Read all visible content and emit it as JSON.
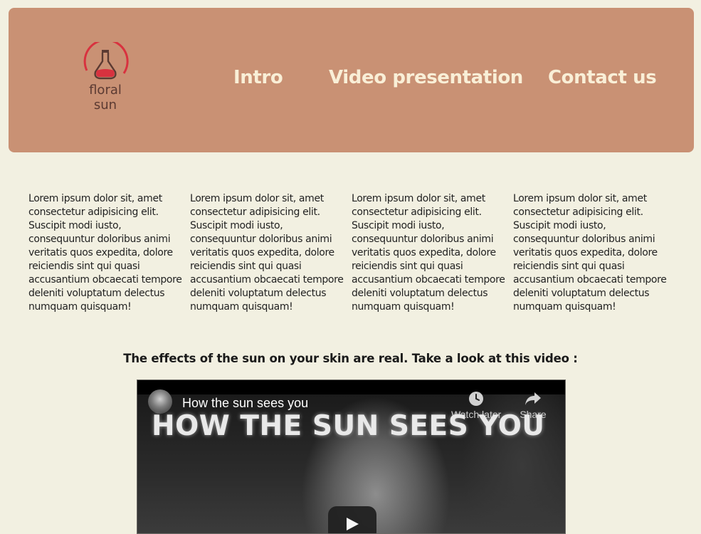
{
  "logo": {
    "line1": "floral",
    "line2": "sun"
  },
  "nav": [
    {
      "label": "Intro"
    },
    {
      "label": "Video presentation"
    },
    {
      "label": "Contact us"
    }
  ],
  "columns": [
    {
      "text": "Lorem ipsum dolor sit, amet consectetur adipisicing elit. Suscipit modi iusto, consequuntur doloribus animi veritatis quos expedita, dolore reiciendis sint qui quasi accusantium obcaecati tempore deleniti voluptatum delectus numquam quisquam!"
    },
    {
      "text": "Lorem ipsum dolor sit, amet consectetur adipisicing elit. Suscipit modi iusto, consequuntur doloribus animi veritatis quos expedita, dolore reiciendis sint qui quasi accusantium obcaecati tempore deleniti voluptatum delectus numquam quisquam!"
    },
    {
      "text": "Lorem ipsum dolor sit, amet consectetur adipisicing elit. Suscipit modi iusto, consequuntur doloribus animi veritatis quos expedita, dolore reiciendis sint qui quasi accusantium obcaecati tempore deleniti voluptatum delectus numquam quisquam!"
    },
    {
      "text": "Lorem ipsum dolor sit, amet consectetur adipisicing elit. Suscipit modi iusto, consequuntur doloribus animi veritatis quos expedita, dolore reiciendis sint qui quasi accusantium obcaecati tempore deleniti voluptatum delectus numquam quisquam!"
    }
  ],
  "video_section": {
    "caption": "The effects of the sun on your skin are real. Take a look at this video :",
    "video": {
      "title": "How the sun sees you",
      "overlay_title": "HOW THE SUN SEES YOU",
      "watch_later_label": "Watch later",
      "share_label": "Share"
    }
  },
  "colors": {
    "header_bg": "#c99174",
    "nav_text": "#f9efd7",
    "page_bg": "#f2f0e1",
    "logo_accent": "#d8323f"
  }
}
